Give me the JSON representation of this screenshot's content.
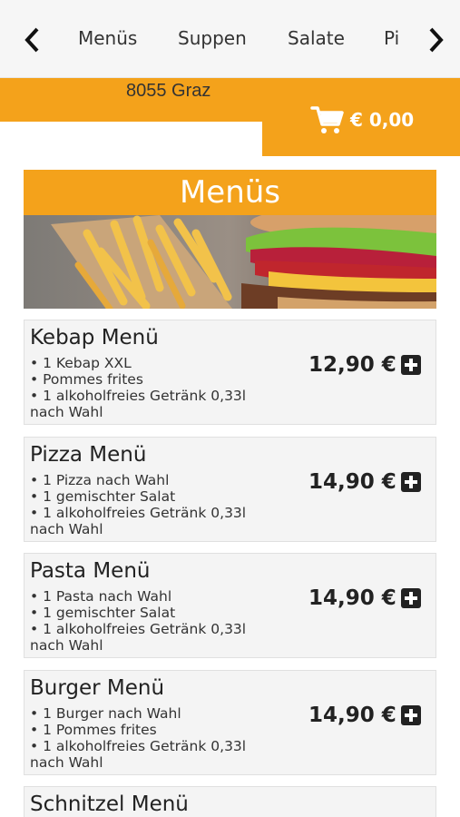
{
  "nav": {
    "tabs": [
      "Menüs",
      "Suppen",
      "Salate",
      "Pi"
    ],
    "prev_icon": "chevron-left-icon",
    "next_icon": "chevron-right-icon"
  },
  "header": {
    "address": "8055 Graz",
    "cart_icon": "shopping-cart-icon",
    "cart_total": "€ 0,00"
  },
  "section": {
    "title": "Menüs",
    "hero_image": "burger-and-fries-photo"
  },
  "menu_items": [
    {
      "name": "Kebap Menü",
      "lines": [
        "• 1 Kebap XXL",
        "• Pommes frites",
        "• 1 alkoholfreies Getränk 0,33l",
        "nach Wahl"
      ],
      "price": "12,90 €",
      "add_icon": "plus-square-icon"
    },
    {
      "name": "Pizza Menü",
      "lines": [
        "• 1 Pizza nach Wahl",
        "• 1 gemischter Salat",
        "• 1 alkoholfreies Getränk 0,33l",
        "nach Wahl"
      ],
      "price": "14,90 €",
      "add_icon": "plus-square-icon"
    },
    {
      "name": "Pasta Menü",
      "lines": [
        "• 1 Pasta nach Wahl",
        "• 1 gemischter Salat",
        "• 1 alkoholfreies Getränk 0,33l",
        "nach Wahl"
      ],
      "price": "14,90 €",
      "add_icon": "plus-square-icon"
    },
    {
      "name": "Burger Menü",
      "lines": [
        "• 1 Burger nach Wahl",
        "• 1 Pommes frites",
        "• 1 alkoholfreies Getränk 0,33l",
        "nach Wahl"
      ],
      "price": "14,90 €",
      "add_icon": "plus-square-icon"
    },
    {
      "name": "Schnitzel Menü"
    }
  ],
  "colors": {
    "accent": "#f4a21b",
    "card_bg": "#f4f4f4",
    "nav_bg": "#f6f6f6"
  }
}
